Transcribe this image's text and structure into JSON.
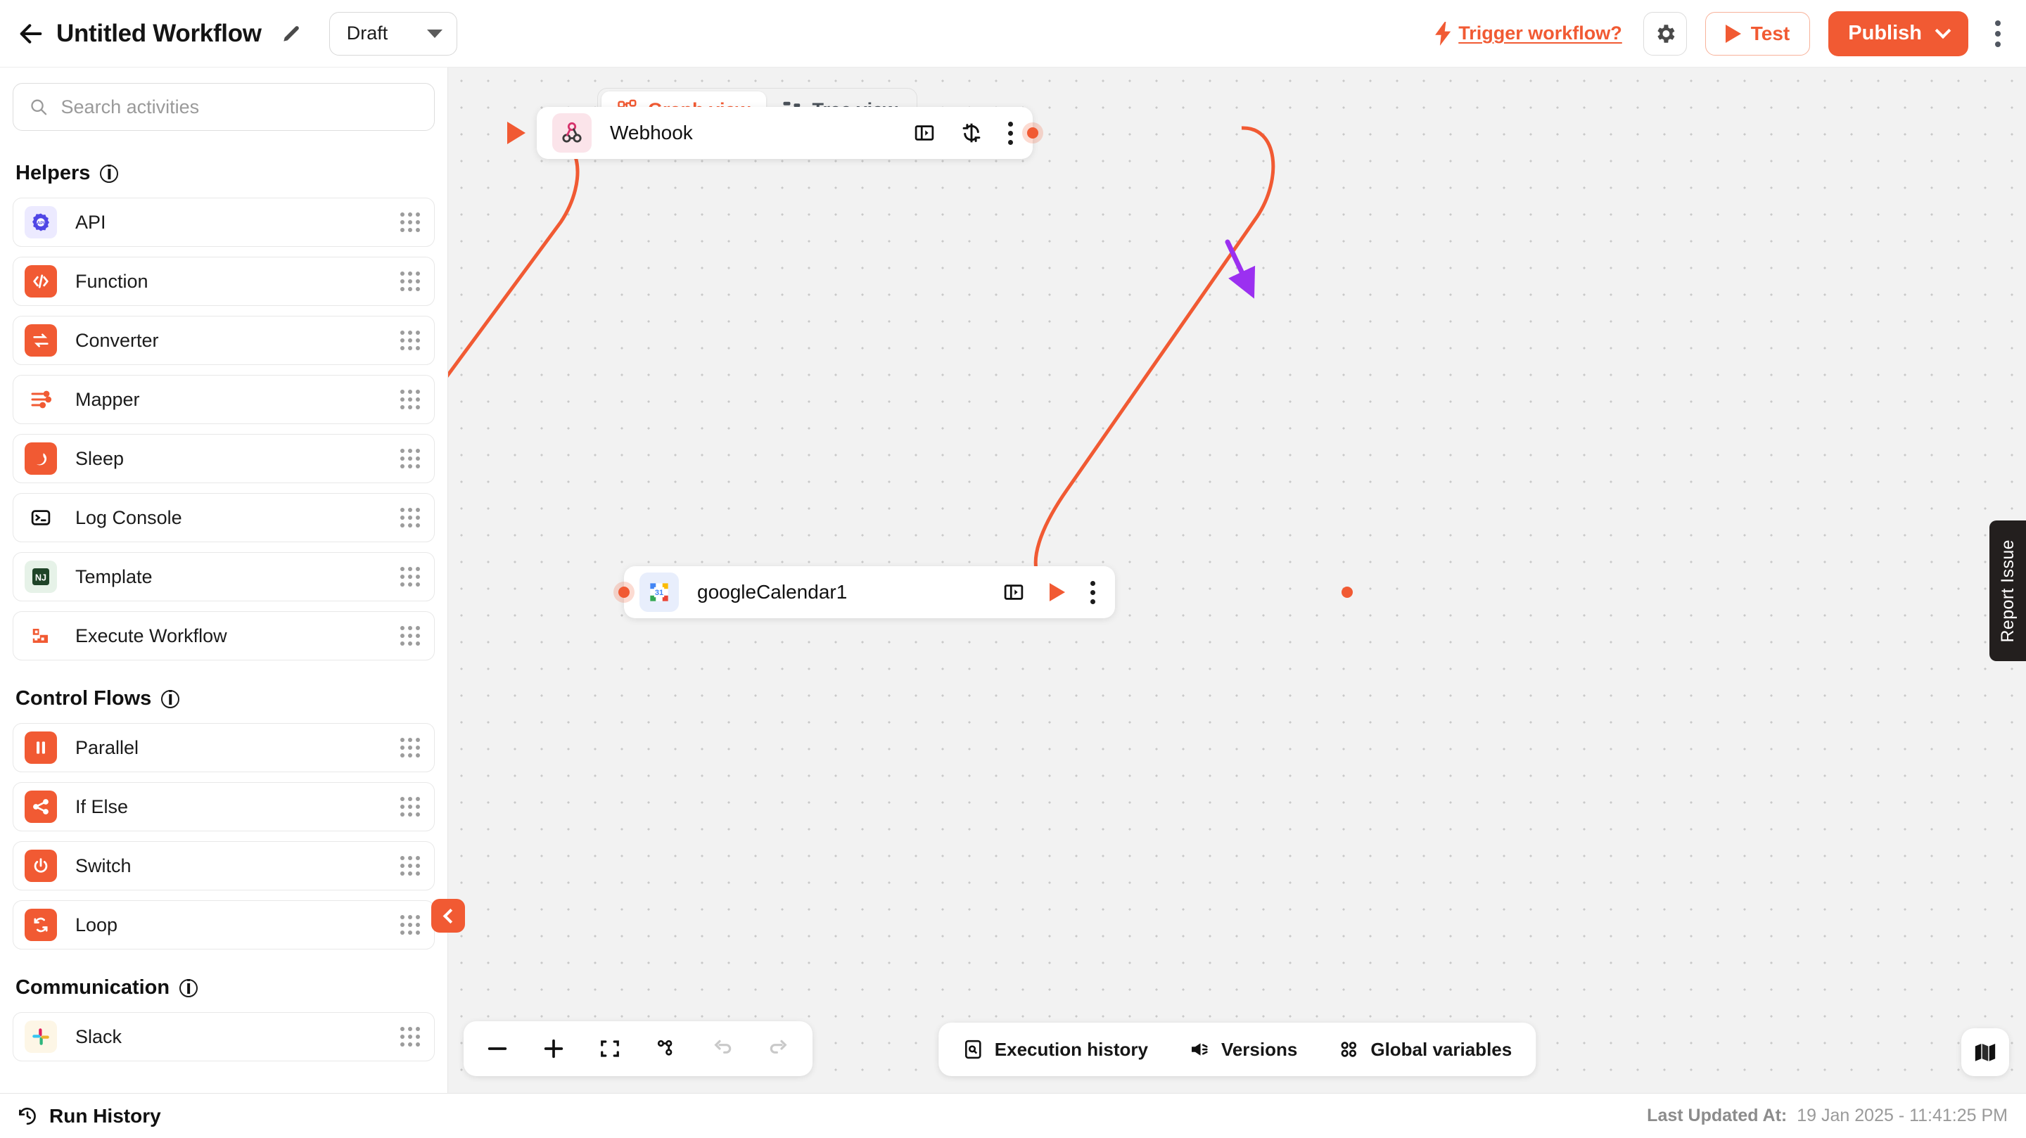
{
  "topbar": {
    "back_icon": "back-arrow-icon",
    "title": "Untitled Workflow",
    "edit_icon": "pencil-icon",
    "status": "Draft",
    "trigger_link": "Trigger workflow?",
    "trigger_icon": "lightning-bolt-icon",
    "settings_icon": "gear-icon",
    "test_label": "Test",
    "publish_label": "Publish",
    "more_icon": "kebab-menu-icon",
    "accent": "#f15a33"
  },
  "sidebar": {
    "search": {
      "value": "",
      "placeholder": "Search activities",
      "icon": "search-icon"
    },
    "sections": [
      {
        "title": "Helpers",
        "info_icon": "info-icon",
        "items": [
          {
            "label": "API",
            "icon": "api-icon",
            "color": "#4f46e5",
            "bg": "#eceaff"
          },
          {
            "label": "Function",
            "icon": "code-icon",
            "color": "#ffffff",
            "bg": "#f15a33"
          },
          {
            "label": "Converter",
            "icon": "convert-icon",
            "color": "#ffffff",
            "bg": "#f15a33"
          },
          {
            "label": "Mapper",
            "icon": "mapper-icon",
            "color": "#f15a33",
            "bg": "#ffffff"
          },
          {
            "label": "Sleep",
            "icon": "moon-icon",
            "color": "#ffffff",
            "bg": "#f15a33"
          },
          {
            "label": "Log Console",
            "icon": "terminal-icon",
            "color": "#111111",
            "bg": "#ffffff"
          },
          {
            "label": "Template",
            "icon": "nunjucks-icon",
            "color": "#1f4428",
            "bg": "#e6f2e8"
          },
          {
            "label": "Execute Workflow",
            "icon": "execute-workflow-icon",
            "color": "#f15a33",
            "bg": "#ffffff"
          }
        ]
      },
      {
        "title": "Control Flows",
        "info_icon": "info-icon",
        "items": [
          {
            "label": "Parallel",
            "icon": "pause-icon",
            "color": "#ffffff",
            "bg": "#f15a33"
          },
          {
            "label": "If Else",
            "icon": "branch-icon",
            "color": "#ffffff",
            "bg": "#f15a33"
          },
          {
            "label": "Switch",
            "icon": "power-icon",
            "color": "#ffffff",
            "bg": "#f15a33"
          },
          {
            "label": "Loop",
            "icon": "loop-icon",
            "color": "#ffffff",
            "bg": "#f15a33"
          }
        ]
      },
      {
        "title": "Communication",
        "info_icon": "info-icon",
        "items": [
          {
            "label": "Slack",
            "icon": "slack-icon",
            "color": "#e01e5a",
            "bg": "#fdf6e6"
          }
        ]
      }
    ],
    "drag_handle_icon": "drag-handle-icon",
    "collapse_icon": "chevron-left-icon"
  },
  "canvas": {
    "view_tabs": [
      {
        "label": "Graph view",
        "icon": "graph-view-icon",
        "active": true
      },
      {
        "label": "Tree view",
        "icon": "tree-view-icon",
        "active": false
      }
    ],
    "nodes": [
      {
        "label": "Webhook",
        "icon": "webhook-icon",
        "actions": [
          "panel-toggle-icon",
          "refresh-icon",
          "kebab-menu-icon"
        ],
        "has_start_marker": true
      },
      {
        "label": "googleCalendar1",
        "icon": "google-calendar-icon",
        "icon_day": "31",
        "actions": [
          "panel-toggle-icon",
          "run-node-icon",
          "kebab-menu-icon"
        ],
        "has_start_marker": false
      }
    ],
    "edge_color": "#f15a33",
    "annotation_arrow_color": "#9b30f0",
    "zoom_tools": [
      "zoom-out-icon",
      "zoom-in-icon",
      "fit-view-icon",
      "auto-layout-icon",
      "undo-icon",
      "redo-icon"
    ],
    "bottom_tools": [
      {
        "label": "Execution history",
        "icon": "execution-history-icon"
      },
      {
        "label": "Versions",
        "icon": "versions-icon"
      },
      {
        "label": "Global variables",
        "icon": "global-variables-icon"
      }
    ],
    "minimap_icon": "map-icon"
  },
  "report_tab": {
    "label": "Report Issue"
  },
  "footer": {
    "run_history": "Run History",
    "run_history_icon": "history-clock-icon",
    "last_updated_label": "Last Updated At:",
    "last_updated_value": "19 Jan 2025 - 11:41:25 PM"
  }
}
